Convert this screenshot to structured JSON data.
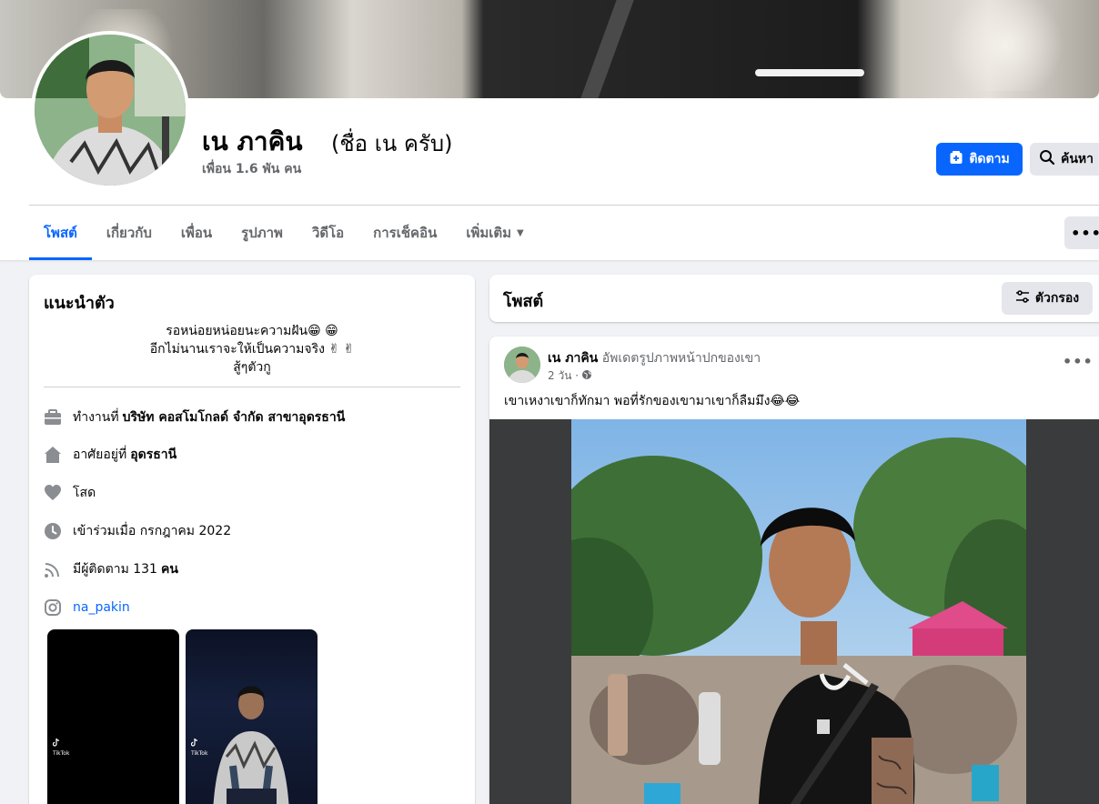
{
  "profile": {
    "name": "เน ภาคิน",
    "alternate_name": "(ชื่อ เน ครับ)",
    "friends": "เพื่อน 1.6 พัน คน"
  },
  "actions": {
    "follow_label": "ติดตาม",
    "search_label": "ค้นหา",
    "more_label": "•••"
  },
  "tabs": [
    {
      "label": "โพสต์",
      "active": true
    },
    {
      "label": "เกี่ยวกับ"
    },
    {
      "label": "เพื่อน"
    },
    {
      "label": "รูปภาพ"
    },
    {
      "label": "วิดีโอ"
    },
    {
      "label": "การเช็คอิน"
    },
    {
      "label": "เพิ่มเติม"
    }
  ],
  "intro": {
    "title": "แนะนำตัว",
    "bio": [
      "รอหน่อยหน่อยนะความฝัน😁 😁",
      "อีกไม่นานเราจะให้เป็นความจริง ✌ ✌",
      "สู้ๆตัวกู"
    ],
    "work_prefix": "ทำงานที่",
    "work_place": "บริษัท คอสโมโกลด์ จำกัด สาขาอุดรธานี",
    "live_prefix": "อาศัยอยู่ที่",
    "live_place": "อุดรธานี",
    "relationship": "โสด",
    "joined": "เข้าร่วมเมื่อ กรกฎาคม 2022",
    "followers_prefix": "มีผู้ติดตาม 131",
    "followers_suffix": "คน",
    "instagram": "na_pakin",
    "featured_watermark": "TikTok"
  },
  "posts_section": {
    "title": "โพสต์",
    "filter_label": "ตัวกรอง"
  },
  "post": {
    "author": "เน ภาคิน",
    "action": "อัพเดตรูปภาพหน้าปกของเขา",
    "time": "2 วัน ·",
    "text": "เขาเหงาเขาก็ทักมา พอที่รักของเขามาเขาก็ลืมมึง😂😂",
    "more": "•••"
  },
  "icons": {
    "work": "briefcase-icon",
    "home": "home-icon",
    "relationship": "heart-icon",
    "joined": "clock-icon",
    "followers": "rss-icon",
    "instagram": "instagram-icon",
    "privacy": "globe-icon",
    "follow": "follow-icon",
    "search": "search-icon",
    "filter": "filter-icon"
  },
  "colors": {
    "accent": "#0866ff",
    "secondary_text": "#65676b",
    "background": "#f0f2f5"
  }
}
